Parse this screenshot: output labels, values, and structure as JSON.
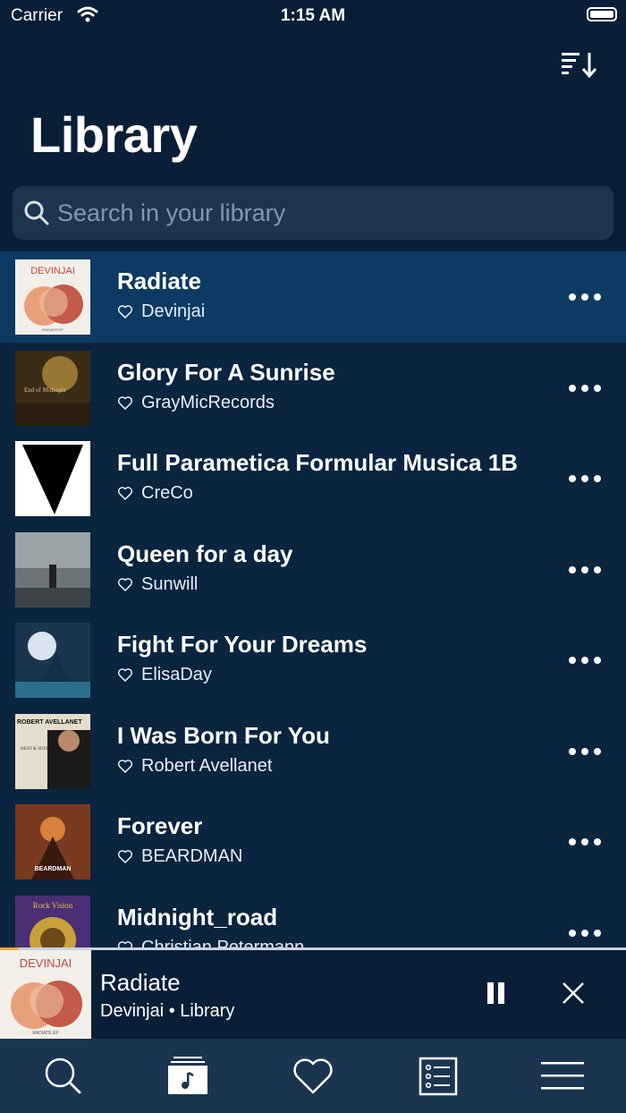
{
  "status_bar": {
    "carrier": "Carrier",
    "time": "1:15 AM"
  },
  "header": {
    "title": "Library",
    "sort_icon": "sort-icon"
  },
  "search": {
    "placeholder": "Search in your library",
    "value": ""
  },
  "tracks": [
    {
      "title": "Radiate",
      "artist": "Devinjai",
      "active": true
    },
    {
      "title": "Glory For A Sunrise",
      "artist": "GrayMicRecords",
      "active": false
    },
    {
      "title": "Full Parametica Formular Musica 1B",
      "artist": "CreCo",
      "active": false
    },
    {
      "title": "Queen for a day",
      "artist": "Sunwill",
      "active": false
    },
    {
      "title": "Fight For Your Dreams",
      "artist": "ElisaDay",
      "active": false
    },
    {
      "title": "I Was Born For You",
      "artist": "Robert Avellanet",
      "active": false
    },
    {
      "title": "Forever",
      "artist": "BEARDMAN",
      "active": false
    },
    {
      "title": "Midnight_road",
      "artist": "Christian Petermann",
      "active": false
    }
  ],
  "album_art_text": {
    "radiate": "DEVINJAI",
    "radiate_footer": "RADIATE EP",
    "glory": "End of Midnight",
    "robert": "ROBERT AVELLANET",
    "robert_sub": "HEAT & SOUL",
    "beardman": "BEARDMAN",
    "midnight": "Rock Vision"
  },
  "now_playing": {
    "title": "Radiate",
    "artist": "Devinjai",
    "source": "Library",
    "progress": 0.03
  },
  "tab_bar": {
    "tabs": [
      "search-icon",
      "library-icon",
      "favorites-icon",
      "playlists-icon",
      "menu-icon"
    ],
    "selected": "library-icon"
  },
  "colors": {
    "background": "#0b2440",
    "header": "#0a1f37",
    "active_row": "#0d3a63",
    "tab_bar": "#1b3551",
    "progress": "#e8a93a"
  }
}
